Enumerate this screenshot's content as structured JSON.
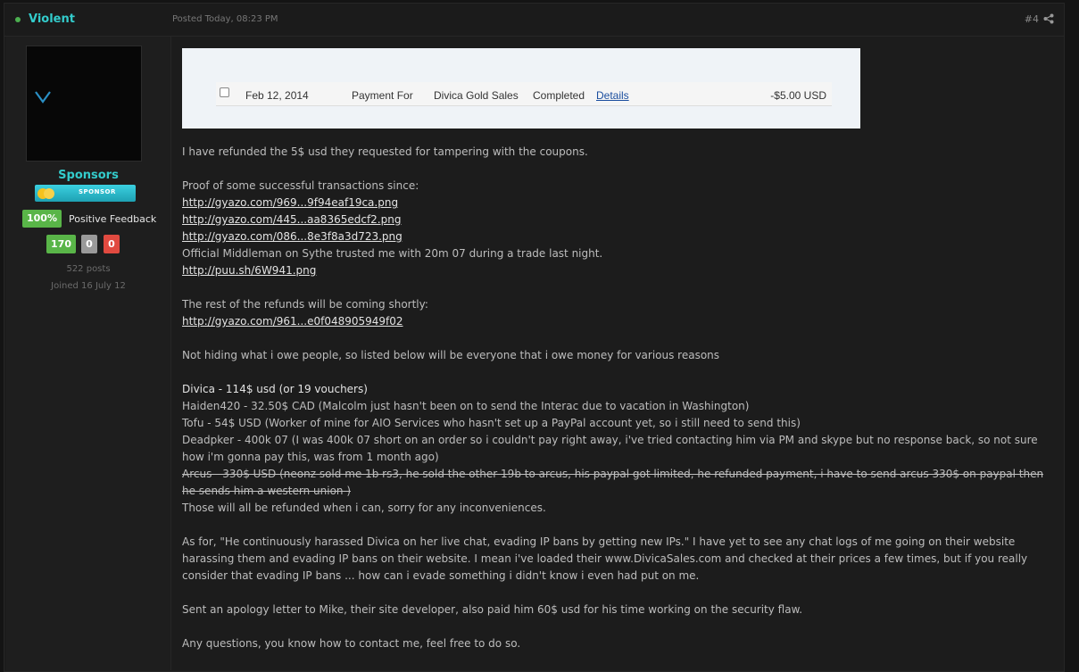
{
  "header": {
    "author": "Violent",
    "posted": "Posted Today, 08:23 PM",
    "post_number": "#4"
  },
  "sidebar": {
    "group": "Sponsors",
    "badge_label": "SPONSOR",
    "feedback_percent": "100%",
    "feedback_label": "Positive Feedback",
    "feedback_positive": "170",
    "feedback_neutral": "0",
    "feedback_negative": "0",
    "posts": "522 posts",
    "joined": "Joined 16 July 12"
  },
  "screenshot": {
    "date": "Feb 12, 2014",
    "type": "Payment For",
    "name": "Divica Gold Sales",
    "status": "Completed",
    "details": "Details",
    "amount": "-$5.00 USD"
  },
  "body": {
    "p1": "I have refunded the 5$ usd they requested for tampering with the coupons.",
    "proof_intro": "Proof of some successful transactions since:",
    "link1": "http://gyazo.com/969...9f94eaf19ca.png",
    "link2": "http://gyazo.com/445...aa8365edcf2.png",
    "link3": "http://gyazo.com/086...8e3f8a3d723.png",
    "middleman": "Official Middleman on Sythe trusted me with 20m 07 during a trade last night.",
    "link4": "http://puu.sh/6W941.png",
    "refunds_intro": "The rest of the refunds will be coming shortly:",
    "link5": "http://gyazo.com/961...e0f048905949f02",
    "owe_intro": "Not hiding what i owe people, so listed below will be everyone that i owe money for various reasons",
    "owe1": "Divica - 114$ usd (or 19 vouchers)",
    "owe2": "Haiden420 - 32.50$ CAD (Malcolm just hasn't been on to send the Interac due to vacation in Washington)",
    "owe3": "Tofu - 54$ USD (Worker of mine for AIO Services who hasn't set up a PayPal account yet, so i still need to send this)",
    "owe4": "Deadpker - 400k 07 (I was 400k 07 short on an order so i couldn't pay right away, i've tried contacting him via PM and skype but no response back, so not sure how i'm gonna pay this, was from 1 month ago)",
    "owe5": "Arcus - 330$ USD (neonz sold me 1b rs3, he sold the other 19b to arcus, his paypal got limited, he refunded payment, i have to send arcus 330$ on paypal then he sends him a western union )",
    "owe_end": "Those will all be refunded when i can, sorry for any inconveniences.",
    "para_harass": "As for, \"He continuously harassed Divica on her live chat, evading IP bans by getting new IPs.\" I have yet to see any chat logs of me going on their website harassing them and evading IP bans on their website. I mean i've loaded their www.DivicaSales.com and checked at their prices a few times, but if you really consider that evading IP bans ... how can i evade something i didn't know i even had put on me.",
    "apology": "Sent an apology letter to Mike, their site developer, also paid him 60$ usd for his time working on the security flaw.",
    "closing": "Any questions, you know how to contact me, feel free to do so."
  }
}
